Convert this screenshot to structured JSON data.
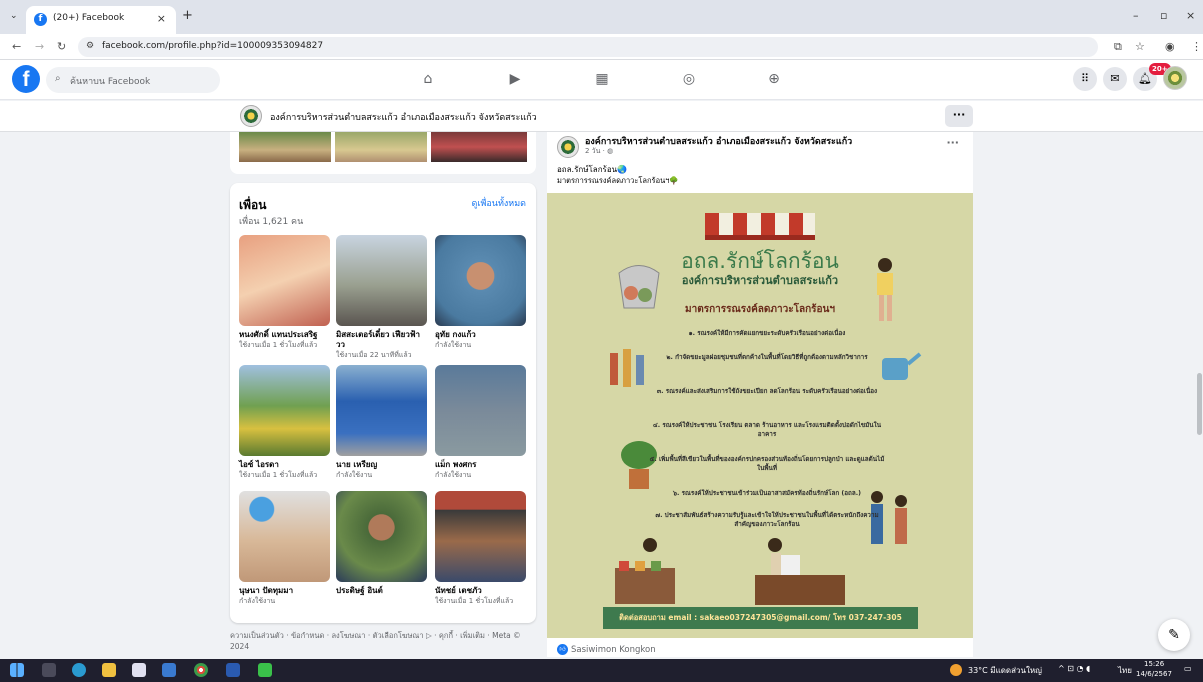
{
  "browser": {
    "tab_title": "(20+) Facebook",
    "tab_close": "×",
    "new_tab": "+",
    "url": "facebook.com/profile.php?id=100009353094827",
    "window_controls": [
      "–",
      "▫",
      "×"
    ]
  },
  "fb": {
    "search_placeholder": "ค้นหาบน Facebook",
    "notification_badge": "20+"
  },
  "page_header": {
    "name": "องค์การบริหารส่วนตำบลสระแก้ว อำเภอเมืองสระแก้ว จังหวัดสระแก้ว",
    "more": "···"
  },
  "friends": {
    "title": "เพื่อน",
    "count": "เพื่อน 1,621 คน",
    "see_all": "ดูเพื่อนทั้งหมด",
    "list": [
      {
        "name": "หนงศักดิ์ แทนประเสริฐ",
        "status": "ใช้งานเมื่อ 1 ชั่วโมงที่แล้ว"
      },
      {
        "name": "มิสสะเตอร์เดี๋ยว เฟียวฟ้าวว",
        "status": "ใช้งานเมื่อ 22 นาทีที่แล้ว"
      },
      {
        "name": "อุทัย กงแก้ว",
        "status": "กำลังใช้งาน"
      },
      {
        "name": "ไอซ์ ไอรดา",
        "status": "ใช้งานเมื่อ 1 ชั่วโมงที่แล้ว"
      },
      {
        "name": "นาย เหรียญ",
        "status": "กำลังใช้งาน"
      },
      {
        "name": "แม็ก พงศกร",
        "status": "กำลังใช้งาน"
      },
      {
        "name": "นุษนา ปัดทุมมา",
        "status": "กำลังใช้งาน"
      },
      {
        "name": "ประดิษฐ์ อินต์",
        "status": ""
      },
      {
        "name": "นัทชย์ เตชภัว",
        "status": "ใช้งานเมื่อ 1 ชั่วโมงที่แล้ว"
      }
    ]
  },
  "footer": "ความเป็นส่วนตัว · ข้อกำหนด · ลงโฆษณา · ตัวเลือกโฆษณา ▷ · คุกกี้ · เพิ่มเติม · Meta © 2024",
  "post": {
    "author": "องค์การบริหารส่วนตำบลสระแก้ว อำเภอเมืองสระแก้ว จังหวัดสระแก้ว",
    "time": "2 วัน · ◍",
    "dots": "···",
    "line1": "อถล.รักษ์โลกร้อน🌏",
    "line2": "มาตรการรณรงค์ลดภาวะโลกร้อนฯ🌳",
    "poster": {
      "title": "อถล.รักษ์โลกร้อน",
      "subtitle": "องค์การบริหารส่วนตำบลสระแก้ว",
      "heading": "มาตรการรณรงค์ลดภาวะโลกร้อนฯ",
      "measures": [
        "๑. รณรงค์ให้มีการคัดแยกขยะระดับครัวเรือนอย่างต่อเนื่อง",
        "๒. กำจัดขยะมูลฝอยชุมชนที่ตกค้างในพื้นที่โดยวิธีที่ถูกต้องตามหลักวิชาการ",
        "๓. รณรงค์และส่งเสริมการใช้ถังขยะเปียก ลดโลกร้อน ระดับครัวเรือนอย่างต่อเนื่อง",
        "๔. รณรงค์ให้ประชาชน โรงเรียน ตลาด ร้านอาหาร และโรงแรมติดตั้งบ่อดักไขมันในอาคาร",
        "๕. เพิ่มพื้นที่สีเขียวในพื้นที่ขององค์กรปกครองส่วนท้องถิ่นโดยการปลูกป่า และดูแลต้นไม้ในพื้นที่",
        "๖. รณรงค์ให้ประชาชนเข้าร่วมเป็นอาสาสมัครท้องถิ่นรักษ์โลก (อถล.)",
        "๗. ประชาสัมพันธ์สร้างความรับรู้และเข้าใจให้ประชาชนในพื้นที่ได้ตระหนักถึงความสำคัญของภาวะโลกร้อน"
      ],
      "contact": "ติดต่อสอบถาม email : sakaeo037247305@gmail.com/ โทร 037-247-305"
    },
    "reaction_name": "Sasiwimon Kongkon"
  },
  "taskbar": {
    "weather": "33°C มีแดดส่วนใหญ่",
    "lang": "ไทย",
    "time": "15:26",
    "date": "14/6/2567"
  }
}
